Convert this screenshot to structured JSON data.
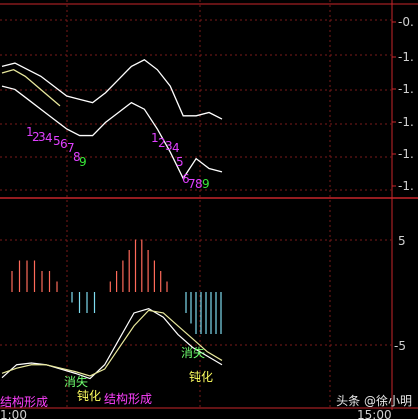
{
  "watermark": "头条 @徐小明",
  "colors": {
    "border": "#c8262a",
    "grid": "#7a1a1a",
    "white_line": "#ffffff",
    "yellow_line": "#e8e89c",
    "histogram_pos": "#ff6a5a",
    "histogram_neg": "#7fdcf0",
    "seq_magenta": "#e040ff",
    "seq_green": "#38e838",
    "label_magenta": "#ff40ff",
    "label_green": "#70ff70",
    "label_yellow": "#ffff60"
  },
  "chart_data": [
    {
      "type": "line",
      "panel": "price",
      "y_tick_labels": [
        "-0.",
        "-1.",
        "-1.",
        "-1.",
        "-1.",
        "-1.",
        "-1."
      ],
      "series": [
        {
          "color": "white",
          "values": [
            -1.06,
            -1.05,
            -1.07,
            -1.09,
            -1.12,
            -1.15,
            -1.16,
            -1.17,
            -1.14,
            -1.1,
            -1.06,
            -1.04,
            -1.07,
            -1.12,
            -1.21,
            -1.21,
            -1.2,
            -1.22
          ]
        },
        {
          "color": "white",
          "values": [
            -1.12,
            -1.13,
            -1.16,
            -1.19,
            -1.22,
            -1.25,
            -1.27,
            -1.27,
            -1.23,
            -1.2,
            -1.17,
            -1.19,
            -1.25,
            -1.32,
            -1.4,
            -1.34,
            -1.37,
            -1.38
          ]
        },
        {
          "color": "yellow",
          "values": [
            -1.08,
            -1.07,
            -1.09,
            -1.12,
            -1.15,
            -1.18
          ]
        }
      ],
      "annotations": [
        {
          "text": "1",
          "color": "magenta"
        },
        {
          "text": "2",
          "color": "magenta"
        },
        {
          "text": "3",
          "color": "magenta"
        },
        {
          "text": "4",
          "color": "magenta"
        },
        {
          "text": "5",
          "color": "magenta"
        },
        {
          "text": "6",
          "color": "magenta"
        },
        {
          "text": "7",
          "color": "magenta"
        },
        {
          "text": "8",
          "color": "magenta"
        },
        {
          "text": "9",
          "color": "green"
        },
        {
          "text": "1",
          "color": "magenta"
        },
        {
          "text": "2",
          "color": "magenta"
        },
        {
          "text": "3",
          "color": "magenta"
        },
        {
          "text": "4",
          "color": "magenta"
        },
        {
          "text": "5",
          "color": "magenta"
        },
        {
          "text": "6",
          "color": "magenta"
        },
        {
          "text": "7",
          "color": "magenta"
        },
        {
          "text": "8",
          "color": "magenta"
        },
        {
          "text": "9",
          "color": "green"
        }
      ]
    },
    {
      "type": "bar",
      "panel": "macd",
      "y_tick_labels": [
        "5",
        "-5"
      ],
      "x_tick_labels": [
        "1:00",
        "15:00"
      ],
      "histogram": [
        2,
        3,
        3,
        3,
        2,
        2,
        1,
        0,
        -1,
        -2,
        -2,
        -2,
        0,
        1,
        2,
        3,
        4,
        5,
        5,
        4,
        3,
        2,
        1,
        0,
        0,
        -2,
        -3,
        -4,
        -4,
        -4,
        -4,
        -4,
        -4
      ],
      "series": [
        {
          "color": "white",
          "values": [
            -7.5,
            -6.0,
            -5.8,
            -6.0,
            -6.5,
            -7.0,
            -7.6,
            -6.0,
            -3.0,
            0.0,
            0.5,
            -0.5,
            -2.5,
            -4.0,
            -5.0,
            -6.0
          ]
        },
        {
          "color": "yellow",
          "values": [
            -7.0,
            -6.4,
            -6.0,
            -6.0,
            -6.4,
            -6.8,
            -7.3,
            -6.5,
            -4.0,
            -1.5,
            0.3,
            0.0,
            -1.5,
            -3.0,
            -4.5,
            -5.5
          ]
        }
      ],
      "annotations": [
        {
          "text": "结构形成",
          "color": "magenta"
        },
        {
          "text": "消失",
          "color": "green"
        },
        {
          "text": "钝化",
          "color": "yellow"
        },
        {
          "text": "结构形成",
          "color": "magenta"
        },
        {
          "text": "消失",
          "color": "green"
        },
        {
          "text": "钝化",
          "color": "yellow"
        }
      ]
    }
  ]
}
